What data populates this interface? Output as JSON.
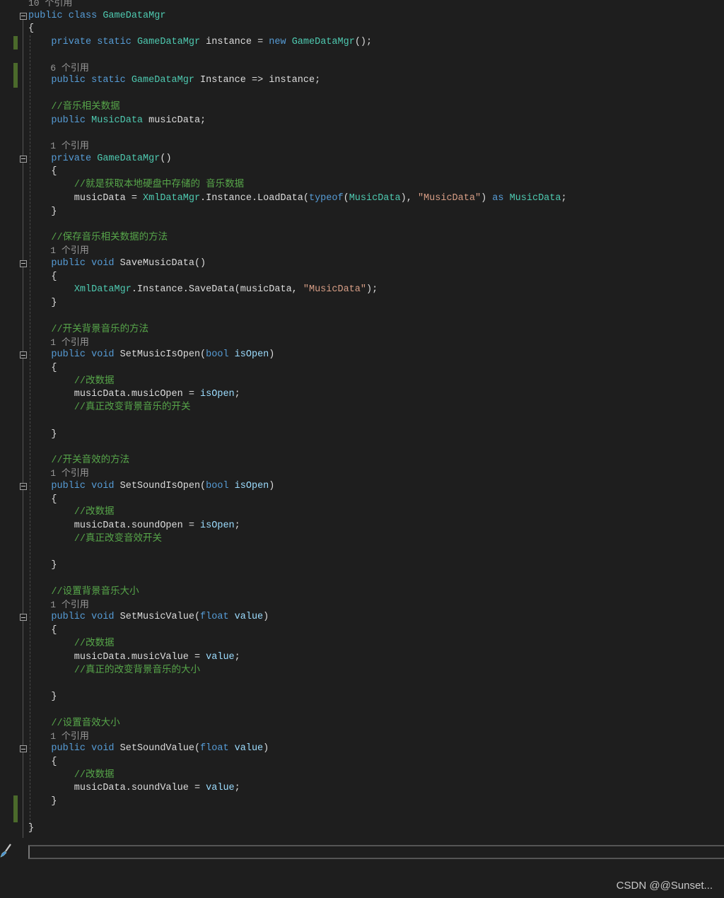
{
  "colors": {
    "background": "#1e1e1e",
    "keyword": "#569cd6",
    "type": "#4ec9b0",
    "comment": "#57a64a",
    "string": "#d69d85",
    "parameter": "#9cdcfe",
    "plain": "#dcdcdc",
    "codelens": "#999999",
    "change_marker": "#4b6a2b"
  },
  "editor": {
    "lines": [
      {
        "kind": "lens",
        "t": [
          [
            "l",
            "10 个引用"
          ]
        ]
      },
      {
        "fold": true,
        "t": [
          [
            "k",
            "public class "
          ],
          [
            "t",
            "GameDataMgr"
          ]
        ]
      },
      {
        "t": [
          [
            "n",
            "{"
          ]
        ]
      },
      {
        "changed": true,
        "t": [
          [
            "n",
            "    "
          ],
          [
            "k",
            "private static "
          ],
          [
            "t",
            "GameDataMgr"
          ],
          [
            "n",
            " instance = "
          ],
          [
            "k",
            "new "
          ],
          [
            "t",
            "GameDataMgr"
          ],
          [
            "n",
            "();"
          ]
        ]
      },
      {
        "t": []
      },
      {
        "kind": "lens",
        "changed": true,
        "t": [
          [
            "n",
            "    "
          ],
          [
            "l",
            "6 个引用"
          ]
        ]
      },
      {
        "changed": true,
        "t": [
          [
            "n",
            "    "
          ],
          [
            "k",
            "public static "
          ],
          [
            "t",
            "GameDataMgr"
          ],
          [
            "n",
            " Instance => instance;"
          ]
        ]
      },
      {
        "t": []
      },
      {
        "t": [
          [
            "n",
            "    "
          ],
          [
            "c",
            "//音乐相关数据"
          ]
        ]
      },
      {
        "t": [
          [
            "n",
            "    "
          ],
          [
            "k",
            "public "
          ],
          [
            "t",
            "MusicData"
          ],
          [
            "n",
            " musicData;"
          ]
        ]
      },
      {
        "t": []
      },
      {
        "kind": "lens",
        "t": [
          [
            "n",
            "    "
          ],
          [
            "l",
            "1 个引用"
          ]
        ]
      },
      {
        "fold": true,
        "t": [
          [
            "n",
            "    "
          ],
          [
            "k",
            "private "
          ],
          [
            "t",
            "GameDataMgr"
          ],
          [
            "n",
            "()"
          ]
        ]
      },
      {
        "t": [
          [
            "n",
            "    {"
          ]
        ]
      },
      {
        "t": [
          [
            "n",
            "        "
          ],
          [
            "c",
            "//就是获取本地硬盘中存储的 音乐数据"
          ]
        ]
      },
      {
        "t": [
          [
            "n",
            "        musicData = "
          ],
          [
            "t",
            "XmlDataMgr"
          ],
          [
            "n",
            ".Instance.LoadData("
          ],
          [
            "k",
            "typeof"
          ],
          [
            "n",
            "("
          ],
          [
            "t",
            "MusicData"
          ],
          [
            "n",
            "), "
          ],
          [
            "s",
            "\"MusicData\""
          ],
          [
            "n",
            ") "
          ],
          [
            "k",
            "as "
          ],
          [
            "t",
            "MusicData"
          ],
          [
            "n",
            ";"
          ]
        ]
      },
      {
        "t": [
          [
            "n",
            "    }"
          ]
        ]
      },
      {
        "t": []
      },
      {
        "t": [
          [
            "n",
            "    "
          ],
          [
            "c",
            "//保存音乐相关数据的方法"
          ]
        ]
      },
      {
        "kind": "lens",
        "t": [
          [
            "n",
            "    "
          ],
          [
            "l",
            "1 个引用"
          ]
        ]
      },
      {
        "fold": true,
        "t": [
          [
            "n",
            "    "
          ],
          [
            "k",
            "public void "
          ],
          [
            "n",
            "SaveMusicData()"
          ]
        ]
      },
      {
        "t": [
          [
            "n",
            "    {"
          ]
        ]
      },
      {
        "t": [
          [
            "n",
            "        "
          ],
          [
            "t",
            "XmlDataMgr"
          ],
          [
            "n",
            ".Instance.SaveData(musicData, "
          ],
          [
            "s",
            "\"MusicData\""
          ],
          [
            "n",
            ");"
          ]
        ]
      },
      {
        "t": [
          [
            "n",
            "    }"
          ]
        ]
      },
      {
        "t": []
      },
      {
        "t": [
          [
            "n",
            "    "
          ],
          [
            "c",
            "//开关背景音乐的方法"
          ]
        ]
      },
      {
        "kind": "lens",
        "t": [
          [
            "n",
            "    "
          ],
          [
            "l",
            "1 个引用"
          ]
        ]
      },
      {
        "fold": true,
        "t": [
          [
            "n",
            "    "
          ],
          [
            "k",
            "public void "
          ],
          [
            "n",
            "SetMusicIsOpen("
          ],
          [
            "k",
            "bool "
          ],
          [
            "p",
            "isOpen"
          ],
          [
            "n",
            ")"
          ]
        ]
      },
      {
        "t": [
          [
            "n",
            "    {"
          ]
        ]
      },
      {
        "t": [
          [
            "n",
            "        "
          ],
          [
            "c",
            "//改数据"
          ]
        ]
      },
      {
        "t": [
          [
            "n",
            "        musicData.musicOpen = "
          ],
          [
            "p",
            "isOpen"
          ],
          [
            "n",
            ";"
          ]
        ]
      },
      {
        "t": [
          [
            "n",
            "        "
          ],
          [
            "c",
            "//真正改变背景音乐的开关"
          ]
        ]
      },
      {
        "t": []
      },
      {
        "t": [
          [
            "n",
            "    }"
          ]
        ]
      },
      {
        "t": []
      },
      {
        "t": [
          [
            "n",
            "    "
          ],
          [
            "c",
            "//开关音效的方法"
          ]
        ]
      },
      {
        "kind": "lens",
        "t": [
          [
            "n",
            "    "
          ],
          [
            "l",
            "1 个引用"
          ]
        ]
      },
      {
        "fold": true,
        "t": [
          [
            "n",
            "    "
          ],
          [
            "k",
            "public void "
          ],
          [
            "n",
            "SetSoundIsOpen("
          ],
          [
            "k",
            "bool "
          ],
          [
            "p",
            "isOpen"
          ],
          [
            "n",
            ")"
          ]
        ]
      },
      {
        "t": [
          [
            "n",
            "    {"
          ]
        ]
      },
      {
        "t": [
          [
            "n",
            "        "
          ],
          [
            "c",
            "//改数据"
          ]
        ]
      },
      {
        "t": [
          [
            "n",
            "        musicData.soundOpen = "
          ],
          [
            "p",
            "isOpen"
          ],
          [
            "n",
            ";"
          ]
        ]
      },
      {
        "t": [
          [
            "n",
            "        "
          ],
          [
            "c",
            "//真正改变音效开关"
          ]
        ]
      },
      {
        "t": []
      },
      {
        "t": [
          [
            "n",
            "    }"
          ]
        ]
      },
      {
        "t": []
      },
      {
        "t": [
          [
            "n",
            "    "
          ],
          [
            "c",
            "//设置背景音乐大小"
          ]
        ]
      },
      {
        "kind": "lens",
        "t": [
          [
            "n",
            "    "
          ],
          [
            "l",
            "1 个引用"
          ]
        ]
      },
      {
        "fold": true,
        "t": [
          [
            "n",
            "    "
          ],
          [
            "k",
            "public void "
          ],
          [
            "n",
            "SetMusicValue("
          ],
          [
            "k",
            "float "
          ],
          [
            "p",
            "value"
          ],
          [
            "n",
            ")"
          ]
        ]
      },
      {
        "t": [
          [
            "n",
            "    {"
          ]
        ]
      },
      {
        "t": [
          [
            "n",
            "        "
          ],
          [
            "c",
            "//改数据"
          ]
        ]
      },
      {
        "t": [
          [
            "n",
            "        musicData.musicValue = "
          ],
          [
            "p",
            "value"
          ],
          [
            "n",
            ";"
          ]
        ]
      },
      {
        "t": [
          [
            "n",
            "        "
          ],
          [
            "c",
            "//真正的改变背景音乐的大小"
          ]
        ]
      },
      {
        "t": []
      },
      {
        "t": [
          [
            "n",
            "    }"
          ]
        ]
      },
      {
        "t": []
      },
      {
        "t": [
          [
            "n",
            "    "
          ],
          [
            "c",
            "//设置音效大小"
          ]
        ]
      },
      {
        "kind": "lens",
        "t": [
          [
            "n",
            "    "
          ],
          [
            "l",
            "1 个引用"
          ]
        ]
      },
      {
        "fold": true,
        "t": [
          [
            "n",
            "    "
          ],
          [
            "k",
            "public void "
          ],
          [
            "n",
            "SetSoundValue("
          ],
          [
            "k",
            "float "
          ],
          [
            "p",
            "value"
          ],
          [
            "n",
            ")"
          ]
        ]
      },
      {
        "t": [
          [
            "n",
            "    {"
          ]
        ]
      },
      {
        "t": [
          [
            "n",
            "        "
          ],
          [
            "c",
            "//改数据"
          ]
        ]
      },
      {
        "t": [
          [
            "n",
            "        musicData.soundValue = "
          ],
          [
            "p",
            "value"
          ],
          [
            "n",
            ";"
          ]
        ]
      },
      {
        "changed": true,
        "t": [
          [
            "n",
            "    }"
          ]
        ]
      },
      {
        "changed": true,
        "t": []
      },
      {
        "t": [
          [
            "n",
            "}"
          ]
        ]
      }
    ]
  },
  "bottom": {
    "brush_icon": "paintbrush-icon"
  },
  "watermark": "CSDN @@Sunset..."
}
